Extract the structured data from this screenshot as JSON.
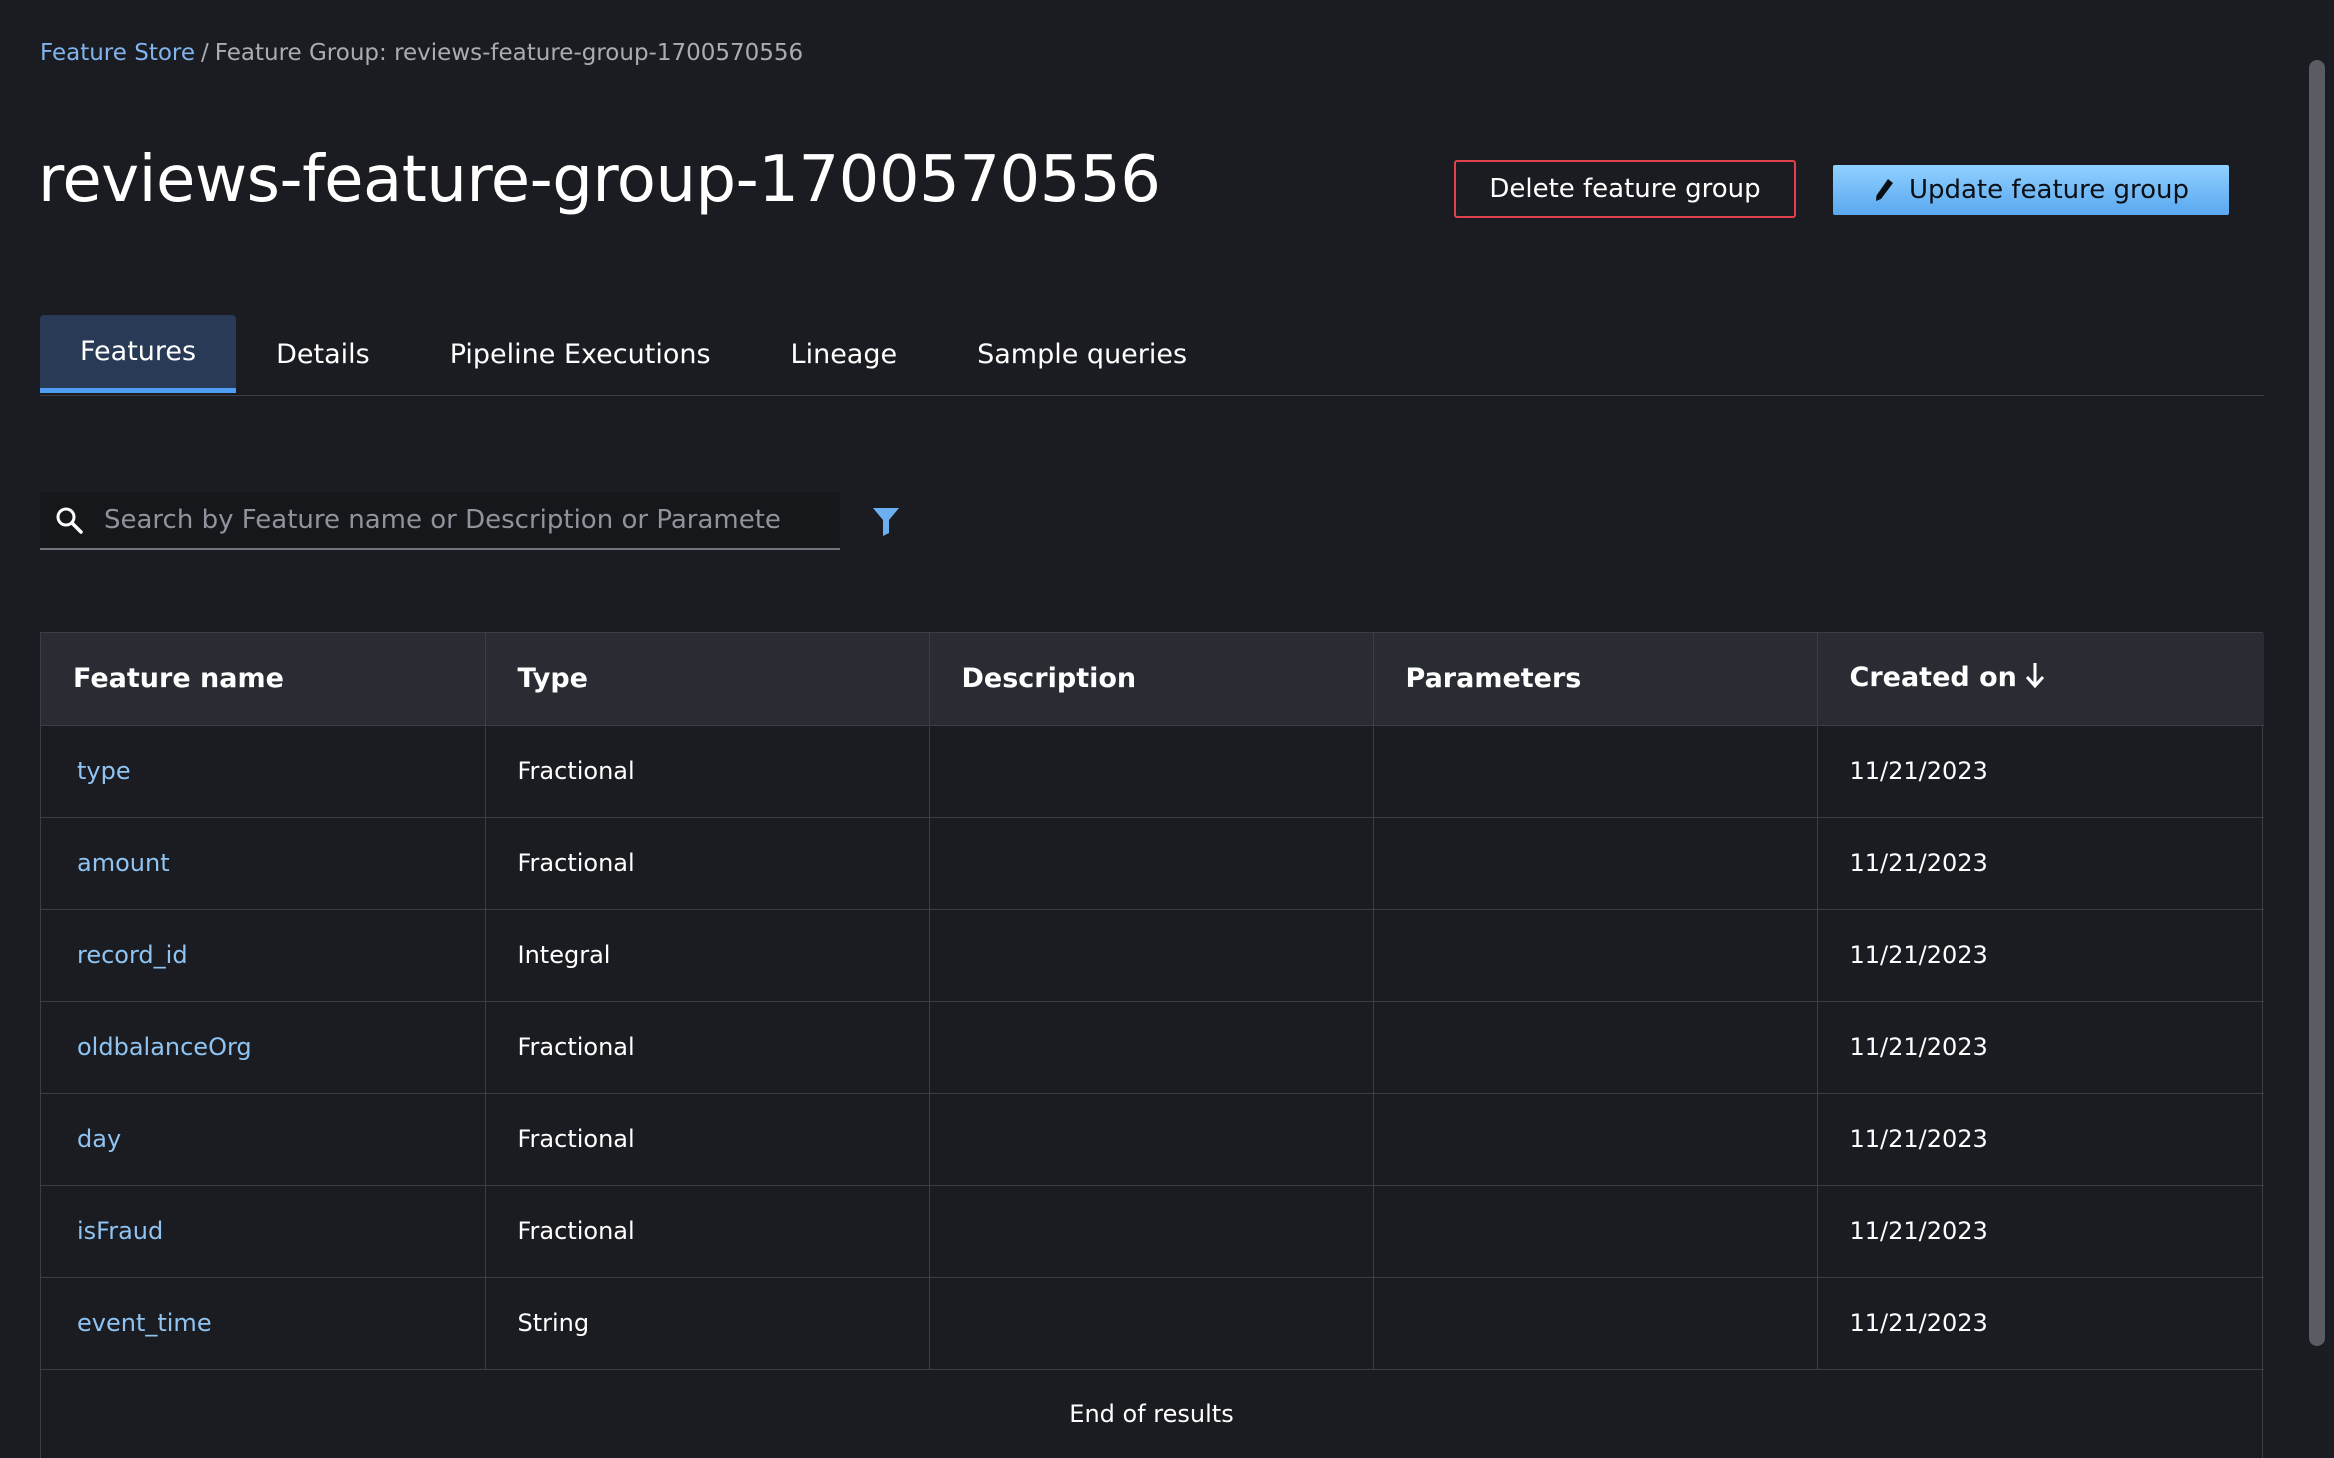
{
  "breadcrumb": {
    "root_label": "Feature Store",
    "separator": "/",
    "current_label": "Feature Group: reviews-feature-group-1700570556"
  },
  "page": {
    "title": "reviews-feature-group-1700570556"
  },
  "actions": {
    "delete_label": "Delete feature group",
    "update_label": "Update feature group",
    "update_icon": "pencil-icon"
  },
  "tabs": [
    {
      "label": "Features",
      "active": true
    },
    {
      "label": "Details",
      "active": false
    },
    {
      "label": "Pipeline Executions",
      "active": false
    },
    {
      "label": "Lineage",
      "active": false
    },
    {
      "label": "Sample queries",
      "active": false
    }
  ],
  "search": {
    "placeholder": "Search by Feature name or Description or Paramete",
    "value": "",
    "icon": "search-icon",
    "filter_icon": "filter-icon"
  },
  "table": {
    "columns": [
      "Feature name",
      "Type",
      "Description",
      "Parameters",
      "Created on"
    ],
    "sort_column": "Created on",
    "sort_direction": "descending",
    "rows": [
      {
        "name": "type",
        "type": "Fractional",
        "description": "",
        "parameters": "",
        "created_on": "11/21/2023"
      },
      {
        "name": "amount",
        "type": "Fractional",
        "description": "",
        "parameters": "",
        "created_on": "11/21/2023"
      },
      {
        "name": "record_id",
        "type": "Integral",
        "description": "",
        "parameters": "",
        "created_on": "11/21/2023"
      },
      {
        "name": "oldbalanceOrg",
        "type": "Fractional",
        "description": "",
        "parameters": "",
        "created_on": "11/21/2023"
      },
      {
        "name": "day",
        "type": "Fractional",
        "description": "",
        "parameters": "",
        "created_on": "11/21/2023"
      },
      {
        "name": "isFraud",
        "type": "Fractional",
        "description": "",
        "parameters": "",
        "created_on": "11/21/2023"
      },
      {
        "name": "event_time",
        "type": "String",
        "description": "",
        "parameters": "",
        "created_on": "11/21/2023"
      }
    ],
    "footer": "End of results"
  },
  "colors": {
    "background": "#1b1c21",
    "link": "#8fc4f2",
    "accent": "#4e9ef7",
    "danger": "#e0414a",
    "primary_button": "#7cc2fc"
  }
}
